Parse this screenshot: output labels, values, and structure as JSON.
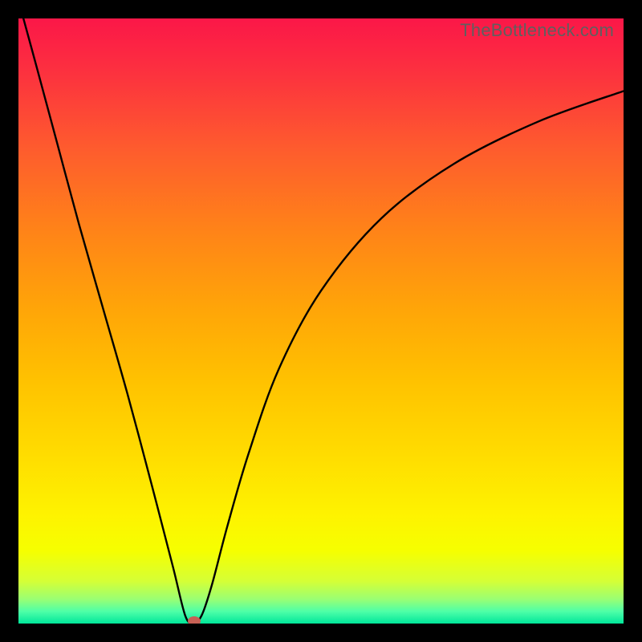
{
  "watermark": "TheBottleneck.com",
  "chart_data": {
    "type": "line",
    "title": "",
    "xlabel": "",
    "ylabel": "",
    "xlim": [
      0,
      100
    ],
    "ylim": [
      0,
      100
    ],
    "background_gradient": {
      "direction": "vertical",
      "stops": [
        {
          "pos": 0.0,
          "color": "#fb1748"
        },
        {
          "pos": 0.5,
          "color": "#ffa508"
        },
        {
          "pos": 0.82,
          "color": "#fef300"
        },
        {
          "pos": 1.0,
          "color": "#00e69a"
        }
      ]
    },
    "series": [
      {
        "name": "bottleneck-curve",
        "x": [
          0.0,
          3.0,
          6.5,
          10.0,
          14.0,
          18.0,
          22.0,
          25.5,
          27.6,
          29.0,
          30.3,
          32.0,
          34.5,
          38.0,
          43.0,
          50.0,
          60.0,
          72.0,
          86.0,
          100.0
        ],
        "values": [
          103.0,
          92.0,
          79.0,
          66.0,
          52.0,
          38.0,
          23.0,
          9.5,
          1.2,
          0.2,
          1.4,
          6.5,
          16.0,
          28.0,
          42.0,
          55.0,
          67.0,
          76.0,
          83.0,
          88.0
        ]
      }
    ],
    "annotations": [
      {
        "name": "min-marker",
        "x": 29.0,
        "y": 0.4,
        "color": "#c76155"
      }
    ]
  }
}
